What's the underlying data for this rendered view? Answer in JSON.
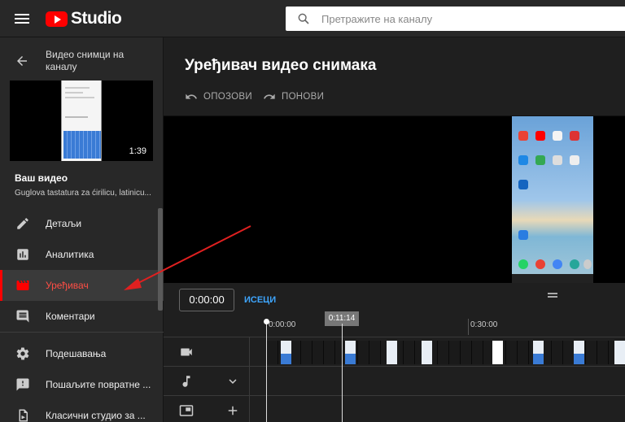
{
  "header": {
    "logo_text": "Studio",
    "search_placeholder": "Претражите на каналу"
  },
  "sidebar": {
    "back_title": "Видео снимци на каналу",
    "thumbnail_duration": "1:39",
    "your_video_label": "Ваш видео",
    "video_name": "Guglova tastatura za ćirilicu, latinicu...",
    "items": [
      {
        "label": "Детаљи",
        "icon": "pencil-icon"
      },
      {
        "label": "Аналитика",
        "icon": "analytics-icon"
      },
      {
        "label": "Уређивач",
        "icon": "clapperboard-icon",
        "active": true
      },
      {
        "label": "Коментари",
        "icon": "comment-icon"
      },
      {
        "label": "Подешавања",
        "icon": "gear-icon"
      },
      {
        "label": "Пошаљите повратне ...",
        "icon": "feedback-icon"
      },
      {
        "label": "Класични студио за ...",
        "icon": "classic-studio-icon"
      }
    ]
  },
  "editor": {
    "title": "Уређивач видео снимака",
    "undo_label": "ОПОЗОВИ",
    "redo_label": "ПОНОВИ",
    "current_time": "0:00:00",
    "trim_label": "ИСЕЦИ",
    "playhead_time": "0:11:14",
    "ruler_labels": [
      "0:00:00",
      "0:30:00"
    ]
  },
  "colors": {
    "accent_red": "#ff0000",
    "active_text": "#ff4e45",
    "link_blue": "#3ea6ff",
    "annotation_arrow": "#e02020"
  }
}
